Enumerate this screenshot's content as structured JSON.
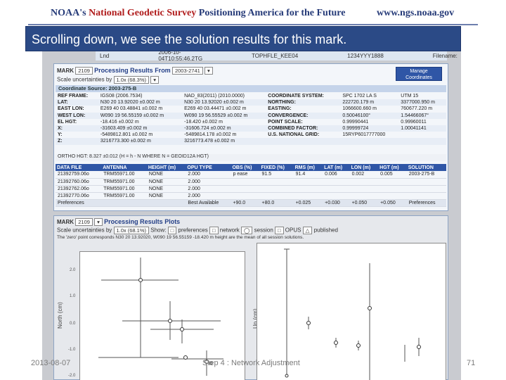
{
  "header": {
    "title_part1": "NOAA's",
    "title_part2": "National Geodetic Survey",
    "title_part3": "Positioning America for the Future",
    "url": "www.ngs.noaa.gov"
  },
  "caption": "Scrolling down, we see the solution results for this mark.",
  "top_strip": {
    "c1": "Lnd",
    "c2": "2006-10-04T10:55:46.2TG",
    "c3": "TOPHFLE_KEE04",
    "c4": "1234YYY1888",
    "c5": "Filename:"
  },
  "results": {
    "mark_label": "MARK",
    "mark_value": "2109",
    "processing_title": "Processing Results From",
    "processing_value": "2003-2741",
    "scale_label": "Scale uncertainties by",
    "scale_value": "1.0x (68.3%)",
    "manage_button": "Manage Coordinates",
    "coord_source": "Coordinate Source: 2003-275-B"
  },
  "coord_table": [
    [
      "REF FRAME:",
      "IGS08 (2006.7534)",
      "NAD_83(2011) (2010.0000)",
      "COORDINATE SYSTEM:",
      "SPC 1702 LA S",
      "UTM 15"
    ],
    [
      "LAT:",
      "N30 20 13.92020 ±0.002 m",
      "N30 20 13.92020 ±0.002 m",
      "NORTHING:",
      "222720.179 m",
      "3377000.950 m"
    ],
    [
      "EAST LON:",
      "E269 40 03.48841 ±0.002 m",
      "E269 40 03.44471 ±0.002 m",
      "EASTING:",
      "1066600.660 m",
      "760677.220 m"
    ],
    [
      "WEST LON:",
      "W090 19 56.55159 ±0.002 m",
      "W090 19 56.55529 ±0.002 m",
      "CONVERGENCE:",
      "0.50046100°",
      "1.54466067°"
    ],
    [
      "EL HGT:",
      "-18.416 ±0.002 m",
      "-18.420 ±0.002 m",
      "POINT SCALE:",
      "0.99990441",
      "0.99960011"
    ],
    [
      "X:",
      "-31603.409 ±0.002 m",
      "-31606.724 ±0.002 m",
      "COMBINED FACTOR:",
      "0.99999724",
      "1.00041141"
    ],
    [
      "Y:",
      "-5489812.801 ±0.002 m",
      "-5489814.178 ±0.002 m",
      "U.S. NATIONAL GRID:",
      "15RYP6017777000",
      ""
    ],
    [
      "Z:",
      "3216773.300 ±0.002 m",
      "3216773.478 ±0.002 m",
      "",
      "",
      ""
    ]
  ],
  "ortho": "ORTHO HGT: 8.327 ±0.012 (H = h - N WHERE N = GEOID12A HGT)",
  "data_table": {
    "headers": [
      "DATA FILE",
      "ANTENNA",
      "HEIGHT (m)",
      "OPU TYPE",
      "OBS (%)",
      "FIXED (%)",
      "RMS (m)",
      "LAT (m)",
      "LON (m)",
      "HGT (m)",
      "SOLUTION"
    ],
    "rows": [
      [
        "21392759.06o",
        "TRM55971.00",
        "NONE",
        "2.000",
        "p ease",
        "91.5",
        "91.4",
        "0.006",
        "0.002",
        "0.005",
        "2003-275-B"
      ],
      [
        "21392760.06o",
        "TRM55971.00",
        "NONE",
        "2.000",
        "",
        "",
        "",
        "",
        "",
        "",
        ""
      ],
      [
        "21392762.06o",
        "TRM55971.00",
        "NONE",
        "2.000",
        "",
        "",
        "",
        "",
        "",
        "",
        ""
      ],
      [
        "21392770.06o",
        "TRM55971.00",
        "NONE",
        "2.000",
        "",
        "",
        "",
        "",
        "",
        "",
        ""
      ]
    ],
    "footer": [
      "Preferences",
      "",
      "",
      "Best Available",
      "+90.0",
      "+80.0",
      "+0.025",
      "+0.030",
      "+0.050",
      "+0.050",
      "Preferences"
    ]
  },
  "plots": {
    "mark_label": "MARK",
    "mark_value": "2109",
    "title": "Processing Results Plots",
    "scale_label": "Scale uncertainties by",
    "scale_value": "1.0x (68.1%)",
    "show_label": "Show:",
    "opt_preferences": "preferences",
    "opt_network": "network",
    "opt_session": "session",
    "opt_opus": "OPUS",
    "opt_published": "published",
    "note": "The 'zero' point corresponds N30 20 13.92020, W090 19 56.55159 -18.420 m height are the mean of all session solutions.",
    "north_label": "North (cm)",
    "up_label": "Up (cm)",
    "north_ticks": [
      "2.0",
      "1.0",
      "0.0",
      "-1.0",
      "-2.0"
    ],
    "up_ticks": [
      "6",
      "4",
      "2"
    ]
  },
  "footer": {
    "date": "2013-08-07",
    "center": "Step 4 : Network Adjustment",
    "page": "71"
  }
}
